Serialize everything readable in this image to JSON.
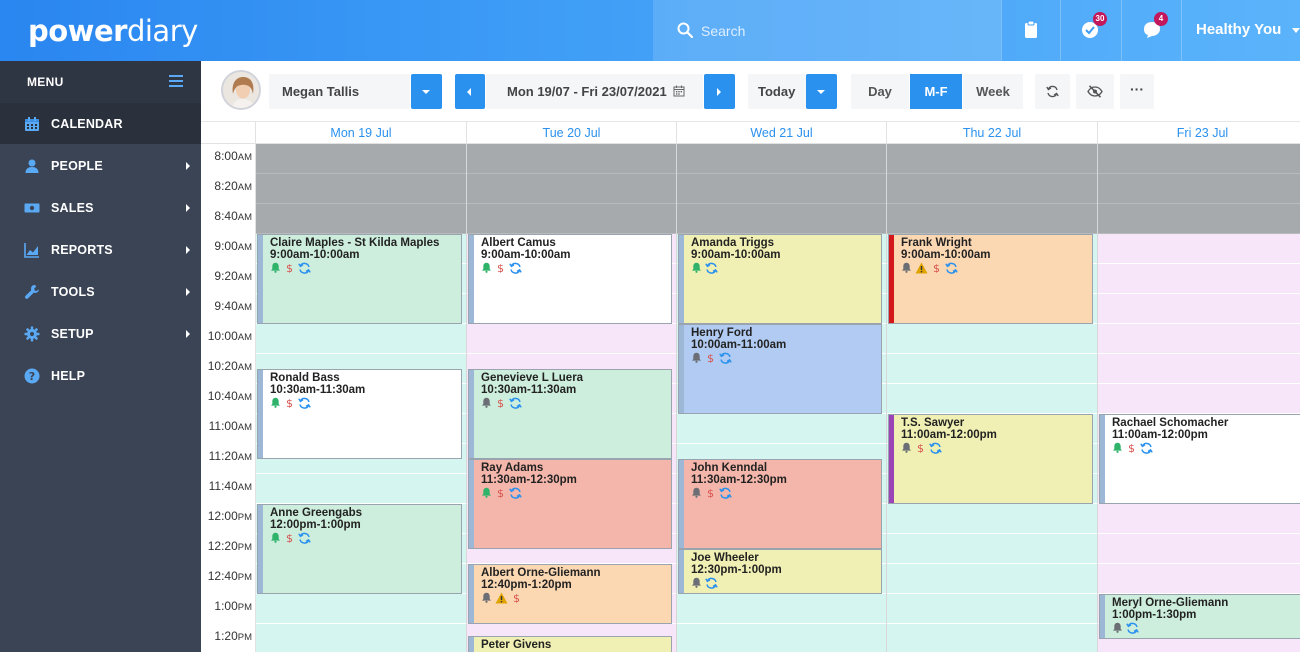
{
  "app": {
    "logo_bold": "power",
    "logo_light": "diary"
  },
  "header": {
    "search_placeholder": "Search",
    "notifications": [
      {
        "name": "clipboard",
        "badge": ""
      },
      {
        "name": "tasks",
        "badge": "30"
      },
      {
        "name": "messages",
        "badge": "4"
      }
    ],
    "user_menu_label": "Healthy You"
  },
  "sidebar": {
    "title": "MENU",
    "items": [
      {
        "label": "CALENDAR",
        "icon": "calendar-icon",
        "active": true,
        "submenu": false
      },
      {
        "label": "PEOPLE",
        "icon": "person-icon",
        "active": false,
        "submenu": true
      },
      {
        "label": "SALES",
        "icon": "money-icon",
        "active": false,
        "submenu": true
      },
      {
        "label": "REPORTS",
        "icon": "chart-icon",
        "active": false,
        "submenu": true
      },
      {
        "label": "TOOLS",
        "icon": "wrench-icon",
        "active": false,
        "submenu": true
      },
      {
        "label": "SETUP",
        "icon": "gear-icon",
        "active": false,
        "submenu": true
      },
      {
        "label": "HELP",
        "icon": "help-icon",
        "active": false,
        "submenu": false
      }
    ]
  },
  "toolbar": {
    "practitioner": "Megan Tallis",
    "date_range": "Mon 19/07 - Fri 23/07/2021",
    "today_label": "Today",
    "views": [
      {
        "label": "Day",
        "on": false
      },
      {
        "label": "M-F",
        "on": true
      },
      {
        "label": "Week",
        "on": false
      }
    ],
    "more_label": "···"
  },
  "calendar": {
    "days": [
      "Mon 19 Jul",
      "Tue 20 Jul",
      "Wed 21 Jul",
      "Thu 22 Jul",
      "Fri 23 Jul"
    ],
    "times": [
      [
        "8:00",
        "AM"
      ],
      [
        "8:20",
        "AM"
      ],
      [
        "8:40",
        "AM"
      ],
      [
        "9:00",
        "AM"
      ],
      [
        "9:20",
        "AM"
      ],
      [
        "9:40",
        "AM"
      ],
      [
        "10:00",
        "AM"
      ],
      [
        "10:20",
        "AM"
      ],
      [
        "10:40",
        "AM"
      ],
      [
        "11:00",
        "AM"
      ],
      [
        "11:20",
        "AM"
      ],
      [
        "11:40",
        "AM"
      ],
      [
        "12:00",
        "PM"
      ],
      [
        "12:20",
        "PM"
      ],
      [
        "12:40",
        "PM"
      ],
      [
        "1:00",
        "PM"
      ],
      [
        "1:20",
        "PM"
      ]
    ],
    "day_bg": [
      "#d5f5f1",
      "#f7e6fa",
      "#d5f5f1",
      "#d5f5f1",
      "#f7e6fa"
    ],
    "appointments": [
      {
        "day": 0,
        "start": 3,
        "slots": 3,
        "name": "Claire Maples - St Kilda Maples",
        "time": "9:00am-10:00am",
        "color": "#cdeedd",
        "bar": "#9db8d6",
        "icons": [
          "bell",
          "dollar",
          "sync"
        ]
      },
      {
        "day": 0,
        "start": 7.5,
        "slots": 3,
        "name": "Ronald Bass",
        "time": "10:30am-11:30am",
        "color": "#ffffff",
        "bar": "#9db8d6",
        "icons": [
          "bell",
          "dollar",
          "sync"
        ]
      },
      {
        "day": 0,
        "start": 12,
        "slots": 3,
        "name": "Anne Greengabs",
        "time": "12:00pm-1:00pm",
        "color": "#cdeedd",
        "bar": "#9db8d6",
        "icons": [
          "bell",
          "dollar",
          "sync"
        ]
      },
      {
        "day": 1,
        "start": 3,
        "slots": 3,
        "name": "Albert Camus",
        "time": "9:00am-10:00am",
        "color": "#ffffff",
        "bar": "#9db8d6",
        "icons": [
          "bell",
          "dollar",
          "sync"
        ]
      },
      {
        "day": 1,
        "start": 7.5,
        "slots": 3,
        "name": "Genevieve L Luera",
        "time": "10:30am-11:30am",
        "color": "#cdeedd",
        "bar": "#9db8d6",
        "icons": [
          "bell-grey",
          "dollar",
          "sync"
        ]
      },
      {
        "day": 1,
        "start": 10.5,
        "slots": 3,
        "name": "Ray Adams",
        "time": "11:30am-12:30pm",
        "color": "#f4b6aa",
        "bar": "#9db8d6",
        "icons": [
          "bell",
          "dollar",
          "sync"
        ]
      },
      {
        "day": 1,
        "start": 14,
        "slots": 2,
        "name": "Albert Orne-Gliemann",
        "time": "12:40pm-1:20pm",
        "color": "#fbd7b2",
        "bar": "#9db8d6",
        "icons": [
          "bell-grey",
          "warning",
          "dollar"
        ]
      },
      {
        "day": 1,
        "start": 16.4,
        "slots": 1,
        "name": "Peter Givens",
        "time": "",
        "color": "#f1f0b4",
        "bar": "#9db8d6",
        "icons": []
      },
      {
        "day": 2,
        "start": 3,
        "slots": 3,
        "name": "Amanda Triggs",
        "time": "9:00am-10:00am",
        "color": "#f1f0b4",
        "bar": "#9db8d6",
        "icons": [
          "bell",
          "sync"
        ]
      },
      {
        "day": 2,
        "start": 6,
        "slots": 3,
        "name": "Henry Ford",
        "time": "10:00am-11:00am",
        "color": "#b1cbf2",
        "bar": "#9db8d6",
        "icons": [
          "bell-grey",
          "dollar",
          "sync"
        ]
      },
      {
        "day": 2,
        "start": 10.5,
        "slots": 3,
        "name": "John Kenndal",
        "time": "11:30am-12:30pm",
        "color": "#f4b6aa",
        "bar": "#9db8d6",
        "icons": [
          "bell-grey",
          "dollar",
          "sync"
        ]
      },
      {
        "day": 2,
        "start": 13.5,
        "slots": 1.5,
        "name": "Joe Wheeler",
        "time": "12:30pm-1:00pm",
        "color": "#f1f0b4",
        "bar": "#9db8d6",
        "icons": [
          "bell-grey",
          "sync"
        ]
      },
      {
        "day": 3,
        "start": 3,
        "slots": 3,
        "name": "Frank Wright",
        "time": "9:00am-10:00am",
        "color": "#fbd7b2",
        "bar": "#d3171b",
        "icons": [
          "bell-grey",
          "warning",
          "dollar",
          "sync"
        ]
      },
      {
        "day": 3,
        "start": 9,
        "slots": 3,
        "name": "T.S. Sawyer",
        "time": "11:00am-12:00pm",
        "color": "#f1f0b4",
        "bar": "#9b44b8",
        "icons": [
          "bell-grey",
          "dollar",
          "sync"
        ]
      },
      {
        "day": 4,
        "start": 9,
        "slots": 3,
        "name": "Rachael Schomacher",
        "time": "11:00am-12:00pm",
        "color": "#ffffff",
        "bar": "#9db8d6",
        "icons": [
          "bell",
          "dollar",
          "sync"
        ]
      },
      {
        "day": 4,
        "start": 15,
        "slots": 1.5,
        "name": "Meryl Orne-Gliemann",
        "time": "1:00pm-1:30pm",
        "color": "#cdeedd",
        "bar": "#9db8d6",
        "icons": [
          "bell-grey",
          "sync"
        ]
      }
    ],
    "colors": {
      "accent": "#2a91ee",
      "closed": "#a7aaad",
      "bell_green": "#2fb36b",
      "bell_grey": "#6b6f75",
      "dollar_red": "#d9534f",
      "sync_blue": "#2a91ee",
      "warning": "#e0a400"
    }
  }
}
